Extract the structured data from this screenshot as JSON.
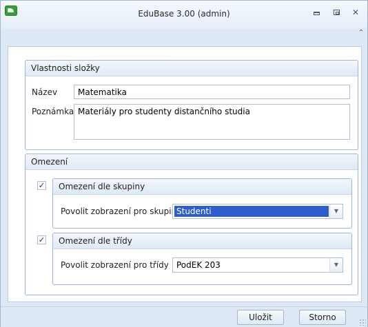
{
  "window": {
    "title": "EduBase 3.00 (admin)",
    "controls": {
      "minimize": "minimize",
      "maximize": "maximize",
      "close": "✕",
      "collapse": "⌃"
    }
  },
  "folder_properties": {
    "header": "Vlastnosti složky",
    "name_label": "Název",
    "name_value": "Matematika",
    "note_label": "Poznámka",
    "note_value": "Materiály pro studenty distančního studia"
  },
  "restrictions": {
    "header": "Omezení",
    "by_group": {
      "checked": true,
      "check_mark": "✓",
      "header": "Omezení dle skupiny",
      "label": "Povolit zobrazení pro skupiny",
      "selected": "Studenti"
    },
    "by_class": {
      "checked": true,
      "check_mark": "✓",
      "header": "Omezení dle třídy",
      "label": "Povolit zobrazení pro třídy",
      "selected": "PodEK 203"
    }
  },
  "footer": {
    "save_label": "Uložit",
    "cancel_label": "Storno"
  },
  "colors": {
    "accent": "#2f5dcc",
    "frame": "#dfe9f5",
    "border": "#9fb6d2"
  }
}
